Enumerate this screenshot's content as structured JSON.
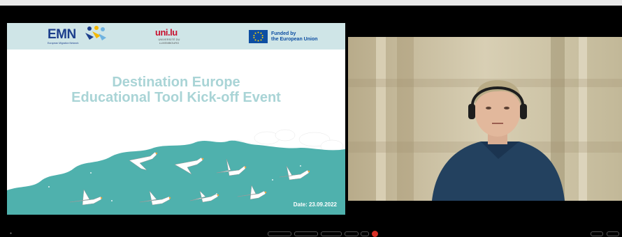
{
  "slide": {
    "emn_name": "EMN",
    "emn_subtitle": "European Migration Network",
    "uni_name": "uni.lu",
    "uni_subtitle_1": "UNIVERSITÉ DU",
    "uni_subtitle_2": "LUXEMBOURG",
    "eu_line1": "Funded by",
    "eu_line2": "the European Union",
    "title_line1": "Destination Europe",
    "title_line2": "Educational Tool Kick-off Event",
    "date": "Date: 23.09.2022"
  },
  "colors": {
    "header_bg": "#cfe5e7",
    "title": "#a9d4d6",
    "teal_wave": "#4fb1ad",
    "end_call": "#d93025"
  }
}
